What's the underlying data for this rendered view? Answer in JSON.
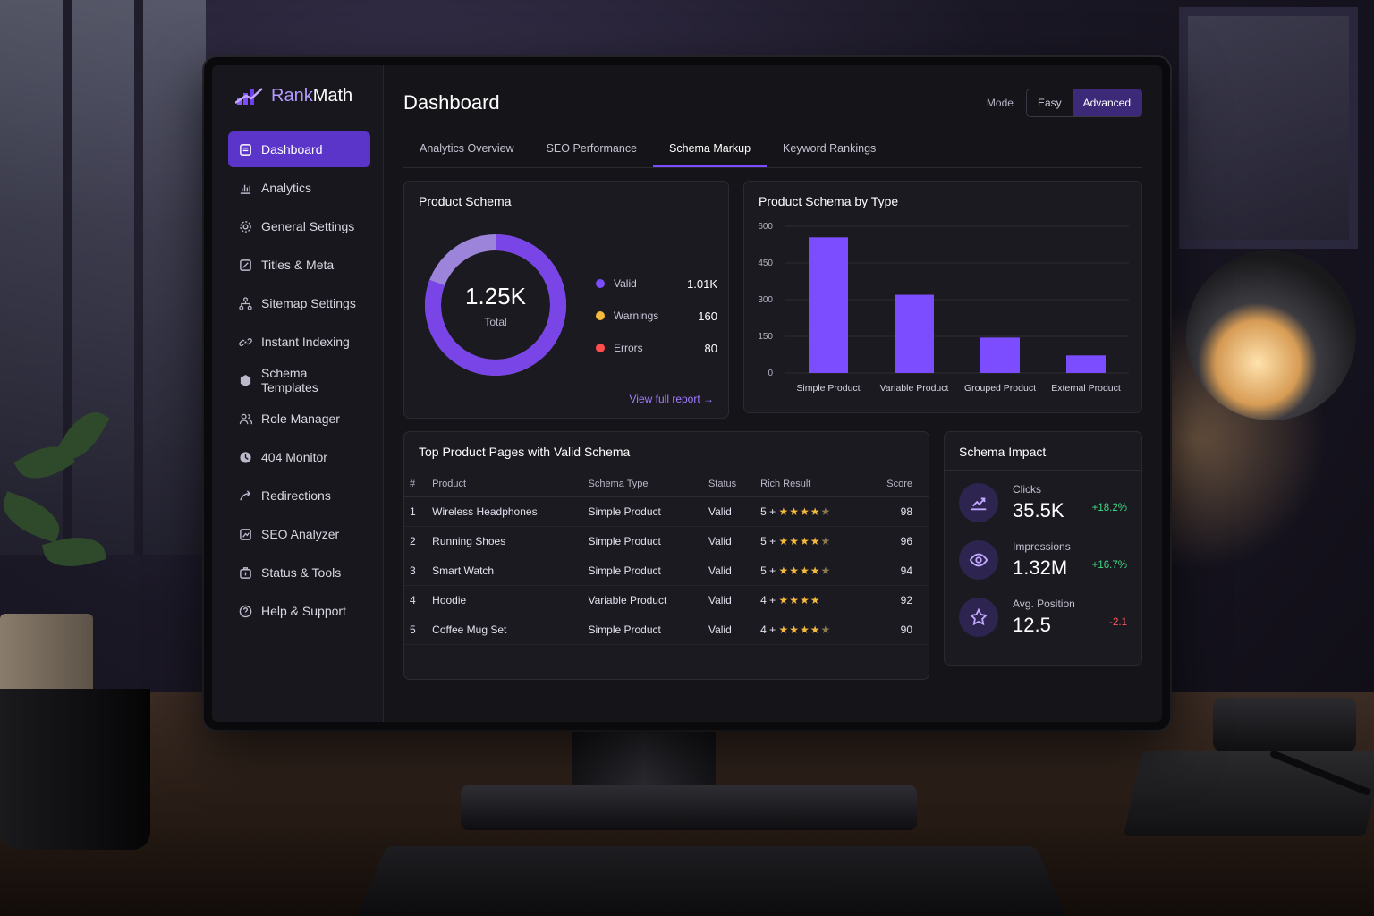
{
  "brand": {
    "name_a": "Rank",
    "name_b": "Math"
  },
  "sidebar": {
    "items": [
      {
        "label": "Dashboard",
        "icon": "dashboard-icon",
        "active": true
      },
      {
        "label": "Analytics",
        "icon": "analytics-icon"
      },
      {
        "label": "General Settings",
        "icon": "gear-icon"
      },
      {
        "label": "Titles & Meta",
        "icon": "edit-icon"
      },
      {
        "label": "Sitemap Settings",
        "icon": "sitemap-icon"
      },
      {
        "label": "Instant Indexing",
        "icon": "link-icon"
      },
      {
        "label": "Schema Templates",
        "icon": "cube-icon"
      },
      {
        "label": "Role Manager",
        "icon": "users-icon"
      },
      {
        "label": "404 Monitor",
        "icon": "monitor-icon"
      },
      {
        "label": "Redirections",
        "icon": "redirect-icon"
      },
      {
        "label": "SEO Analyzer",
        "icon": "analyzer-icon"
      },
      {
        "label": "Status & Tools",
        "icon": "tools-icon"
      },
      {
        "label": "Help & Support",
        "icon": "help-icon"
      }
    ]
  },
  "header": {
    "title": "Dashboard",
    "mode_label": "Mode",
    "mode_options": [
      "Easy",
      "Advanced"
    ],
    "mode_selected": "Advanced"
  },
  "tabs": [
    {
      "label": "Analytics Overview"
    },
    {
      "label": "SEO Performance"
    },
    {
      "label": "Schema Markup",
      "active": true
    },
    {
      "label": "Keyword Rankings"
    }
  ],
  "product_schema": {
    "title": "Product Schema",
    "total_value": "1.25K",
    "total_label": "Total",
    "legend": [
      {
        "label": "Valid",
        "value": "1.01K",
        "color": "#7c4dff"
      },
      {
        "label": "Warnings",
        "value": "160",
        "color": "#f5b93c"
      },
      {
        "label": "Errors",
        "value": "80",
        "color": "#ff4d4d"
      }
    ],
    "link": "View full report →"
  },
  "chart_data": {
    "type": "bar",
    "title": "Product Schema by Type",
    "categories": [
      "Simple Product",
      "Variable Product",
      "Grouped Product",
      "External Product"
    ],
    "values": [
      555,
      320,
      145,
      72
    ],
    "yticks": [
      0,
      150,
      300,
      450,
      600
    ],
    "ylim": [
      0,
      600
    ],
    "xlabel": "",
    "ylabel": "",
    "grid": true,
    "color": "#7c4dff"
  },
  "top_pages": {
    "title": "Top Product Pages with Valid Schema",
    "columns": [
      "#",
      "Product",
      "Schema Type",
      "Status",
      "Rich Result",
      "Score"
    ],
    "rows": [
      {
        "rank": "1",
        "product": "Wireless Headphones",
        "type": "Simple Product",
        "status": "Valid",
        "rich": "5 +",
        "stars": 4.5,
        "score": "98"
      },
      {
        "rank": "2",
        "product": "Running Shoes",
        "type": "Simple Product",
        "status": "Valid",
        "rich": "5 +",
        "stars": 4.5,
        "score": "96"
      },
      {
        "rank": "3",
        "product": "Smart Watch",
        "type": "Simple Product",
        "status": "Valid",
        "rich": "5 +",
        "stars": 4.5,
        "score": "94"
      },
      {
        "rank": "4",
        "product": "Hoodie",
        "type": "Variable Product",
        "status": "Valid",
        "rich": "4 +",
        "stars": 4,
        "score": "92"
      },
      {
        "rank": "5",
        "product": "Coffee Mug Set",
        "type": "Simple Product",
        "status": "Valid",
        "rich": "4 +",
        "stars": 4.5,
        "score": "90"
      }
    ]
  },
  "impact": {
    "title": "Schema Impact",
    "items": [
      {
        "label": "Clicks",
        "value": "35.5K",
        "delta": "+18.2%",
        "trend": "up",
        "icon": "trend-up-icon"
      },
      {
        "label": "Impressions",
        "value": "1.32M",
        "delta": "+16.7%",
        "trend": "up",
        "icon": "eye-icon"
      },
      {
        "label": "Avg. Position",
        "value": "12.5",
        "delta": "-2.1",
        "trend": "down",
        "icon": "star-icon"
      }
    ]
  }
}
